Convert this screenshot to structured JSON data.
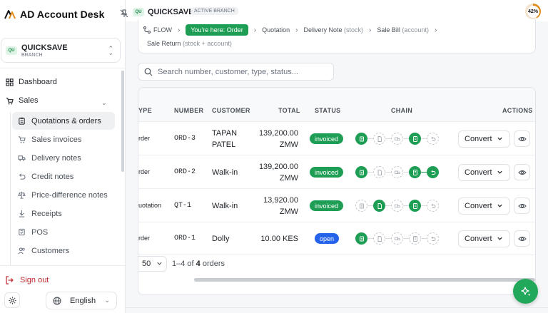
{
  "app": {
    "name": "AD Account Desk"
  },
  "branch": {
    "badge": "QU",
    "name": "QUICKSAVE",
    "sub": "BRANCH"
  },
  "nav": {
    "dashboard": "Dashboard",
    "sales": "Sales",
    "sub_items": [
      {
        "label": "Quotations & orders",
        "icon": "clipboard-icon",
        "active": true
      },
      {
        "label": "Sales invoices",
        "icon": "cart-icon"
      },
      {
        "label": "Delivery notes",
        "icon": "truck-icon"
      },
      {
        "label": "Credit notes",
        "icon": "undo-icon"
      },
      {
        "label": "Price-difference notes",
        "icon": "scale-icon"
      },
      {
        "label": "Receipts",
        "icon": "download-icon"
      },
      {
        "label": "POS",
        "icon": "register-icon"
      },
      {
        "label": "Customers",
        "icon": "users-icon"
      }
    ],
    "sign_out": "Sign out"
  },
  "footer": {
    "language": "English"
  },
  "topbar": {
    "badge": "QU",
    "branch": "QUICKSAVE",
    "active_branch": "ACTIVE BRANCH",
    "progress_label": "42%",
    "progress": 0.42
  },
  "flow": {
    "label": "FLOW",
    "here": "You're here: Order",
    "steps": [
      {
        "name": "Quotation",
        "note": ""
      },
      {
        "name": "Delivery Note",
        "note": "(stock)"
      },
      {
        "name": "Sale Bill",
        "note": "(account)"
      }
    ],
    "last": {
      "name": "Sale Return",
      "note": "(stock + account)"
    }
  },
  "search": {
    "placeholder": "Search number, customer, type, status..."
  },
  "table": {
    "headers": {
      "type": "YPE",
      "number": "NUMBER",
      "customer": "CUSTOMER",
      "total": "TOTAL",
      "status": "STATUS",
      "chain": "CHAIN",
      "actions": "ACTIONS"
    },
    "rows": [
      {
        "type": "rder",
        "number": "ORD-3",
        "customer_line1": "TAPAN",
        "customer_line2": "PATEL",
        "total_line1": "139,200.00",
        "total_line2": "ZMW",
        "status": "invoiced",
        "action": "Convert",
        "chain": [
          true,
          false,
          false,
          true,
          false
        ]
      },
      {
        "type": "rder",
        "number": "ORD-2",
        "customer_line1": "Walk-in",
        "customer_line2": "",
        "total_line1": "139,200.00",
        "total_line2": "ZMW",
        "status": "invoiced",
        "action": "Convert",
        "chain": [
          true,
          false,
          false,
          true,
          true
        ]
      },
      {
        "type": "uotation",
        "number": "QT-1",
        "customer_line1": "Walk-in",
        "customer_line2": "",
        "total_line1": "13,920.00",
        "total_line2": "ZMW",
        "status": "invoiced",
        "action": "Convert",
        "chain": [
          false,
          true,
          false,
          true,
          false
        ]
      },
      {
        "type": "rder",
        "number": "ORD-1",
        "customer_line1": "Dolly",
        "customer_line2": "",
        "total_line1": "10.00 KES",
        "total_line2": "",
        "status": "open",
        "action": "Convert",
        "chain": [
          true,
          false,
          false,
          false,
          false
        ]
      }
    ],
    "page_size": "50",
    "range_prefix": "1–4 of ",
    "range_count": "4",
    "range_suffix": " orders"
  },
  "colors": {
    "accent": "#1e9e55",
    "open": "#2563eb",
    "danger": "#c0262d",
    "gauge": "#e28a1a"
  }
}
